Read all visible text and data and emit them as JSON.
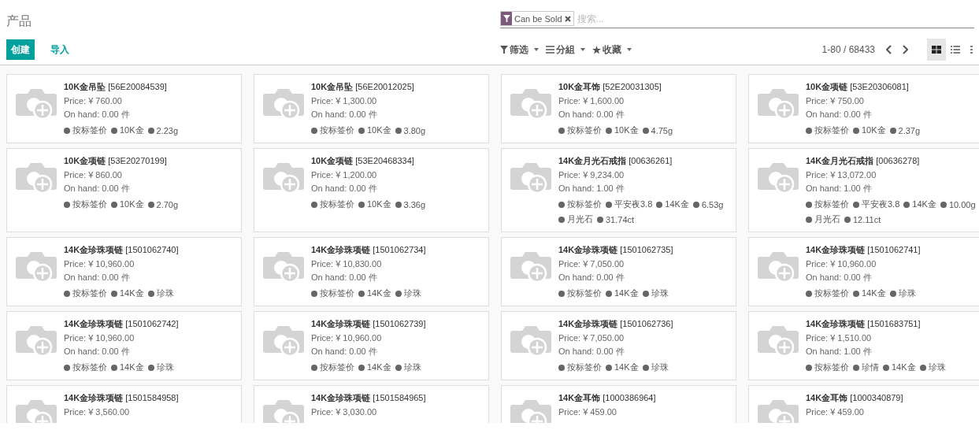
{
  "title": "产品",
  "buttons": [
    {
      "label": "创建",
      "kind": "primary"
    },
    {
      "label": "导入",
      "kind": "link"
    }
  ],
  "search": {
    "facet": "Can be Sold",
    "placeholder": "搜索..."
  },
  "menus": [
    {
      "label": "筛选",
      "kind": "filter"
    },
    {
      "label": "分組",
      "kind": "group"
    },
    {
      "label": "收藏",
      "kind": "favorite"
    }
  ],
  "pager": "1-80 / 68433",
  "views": [
    {
      "kind": "kanban",
      "selected": true
    },
    {
      "kind": "list",
      "selected": false
    },
    {
      "kind": "map",
      "selected": false
    }
  ],
  "products": [
    {
      "name": "10K金吊坠",
      "code": "[56E20084539]",
      "price": "Price: ¥ 760.00",
      "on_hand": "On hand: 0.00 件",
      "tags": [
        "按标签价",
        "10K金",
        "2.23g"
      ]
    },
    {
      "name": "10K金吊坠",
      "code": "[56E20012025]",
      "price": "Price: ¥ 1,300.00",
      "on_hand": "On hand: 0.00 件",
      "tags": [
        "按标签价",
        "10K金",
        "3.80g"
      ]
    },
    {
      "name": "10K金耳饰",
      "code": "[52E20031305]",
      "price": "Price: ¥ 1,600.00",
      "on_hand": "On hand: 0.00 件",
      "tags": [
        "按标签价",
        "10K金",
        "4.75g"
      ]
    },
    {
      "name": "10K金项链",
      "code": "[53E20306081]",
      "price": "Price: ¥ 750.00",
      "on_hand": "On hand: 0.00 件",
      "tags": [
        "按标签价",
        "10K金",
        "2.37g"
      ]
    },
    {
      "name": "10K金项链",
      "code": "[53E20270199]",
      "price": "Price: ¥ 860.00",
      "on_hand": "On hand: 0.00 件",
      "tags": [
        "按标签价",
        "10K金",
        "2.70g"
      ]
    },
    {
      "name": "10K金项链",
      "code": "[53E20468334]",
      "price": "Price: ¥ 1,200.00",
      "on_hand": "On hand: 0.00 件",
      "tags": [
        "按标签价",
        "10K金",
        "3.36g"
      ]
    },
    {
      "name": "14K金月光石戒指",
      "code": "[00636261]",
      "price": "Price: ¥ 9,234.00",
      "on_hand": "On hand: 1.00 件",
      "tags": [
        "按标签价",
        "平安夜3.8",
        "14K金",
        "6.53g",
        "月光石",
        "31.74ct"
      ]
    },
    {
      "name": "14K金月光石戒指",
      "code": "[00636278]",
      "price": "Price: ¥ 13,072.00",
      "on_hand": "On hand: 1.00 件",
      "tags": [
        "按标签价",
        "平安夜3.8",
        "14K金",
        "10.00g",
        "月光石",
        "12.11ct"
      ]
    },
    {
      "name": "14K金珍珠项链",
      "code": "[1501062740]",
      "price": "Price: ¥ 10,960.00",
      "on_hand": "On hand: 0.00 件",
      "tags": [
        "按标签价",
        "14K金",
        "珍珠"
      ]
    },
    {
      "name": "14K金珍珠项链",
      "code": "[1501062734]",
      "price": "Price: ¥ 10,830.00",
      "on_hand": "On hand: 0.00 件",
      "tags": [
        "按标签价",
        "14K金",
        "珍珠"
      ]
    },
    {
      "name": "14K金珍珠项链",
      "code": "[1501062735]",
      "price": "Price: ¥ 7,050.00",
      "on_hand": "On hand: 0.00 件",
      "tags": [
        "按标签价",
        "14K金",
        "珍珠"
      ]
    },
    {
      "name": "14K金珍珠项链",
      "code": "[1501062741]",
      "price": "Price: ¥ 10,960.00",
      "on_hand": "On hand: 0.00 件",
      "tags": [
        "按标签价",
        "14K金",
        "珍珠"
      ]
    },
    {
      "name": "14K金珍珠项链",
      "code": "[1501062742]",
      "price": "Price: ¥ 10,960.00",
      "on_hand": "On hand: 0.00 件",
      "tags": [
        "按标签价",
        "14K金",
        "珍珠"
      ]
    },
    {
      "name": "14K金珍珠项链",
      "code": "[1501062739]",
      "price": "Price: ¥ 10,960.00",
      "on_hand": "On hand: 0.00 件",
      "tags": [
        "按标签价",
        "14K金",
        "珍珠"
      ]
    },
    {
      "name": "14K金珍珠项链",
      "code": "[1501062736]",
      "price": "Price: ¥ 7,050.00",
      "on_hand": "On hand: 0.00 件",
      "tags": [
        "按标签价",
        "14K金",
        "珍珠"
      ]
    },
    {
      "name": "14K金珍珠项链",
      "code": "[1501683751]",
      "price": "Price: ¥ 1,510.00",
      "on_hand": "On hand: 1.00 件",
      "tags": [
        "按标签价",
        "珍情",
        "14K金",
        "珍珠"
      ]
    },
    {
      "name": "14K金珍珠项链",
      "code": "[1501584958]",
      "price": "Price: ¥ 3,560.00"
    },
    {
      "name": "14K金珍珠项链",
      "code": "[1501584965]",
      "price": "Price: ¥ 3,030.00"
    },
    {
      "name": "14K金耳饰",
      "code": "[1000386964]",
      "price": "Price: ¥ 459.00"
    },
    {
      "name": "14K金耳饰",
      "code": "[1000340879]",
      "price": "Price: ¥ 459.00"
    }
  ]
}
